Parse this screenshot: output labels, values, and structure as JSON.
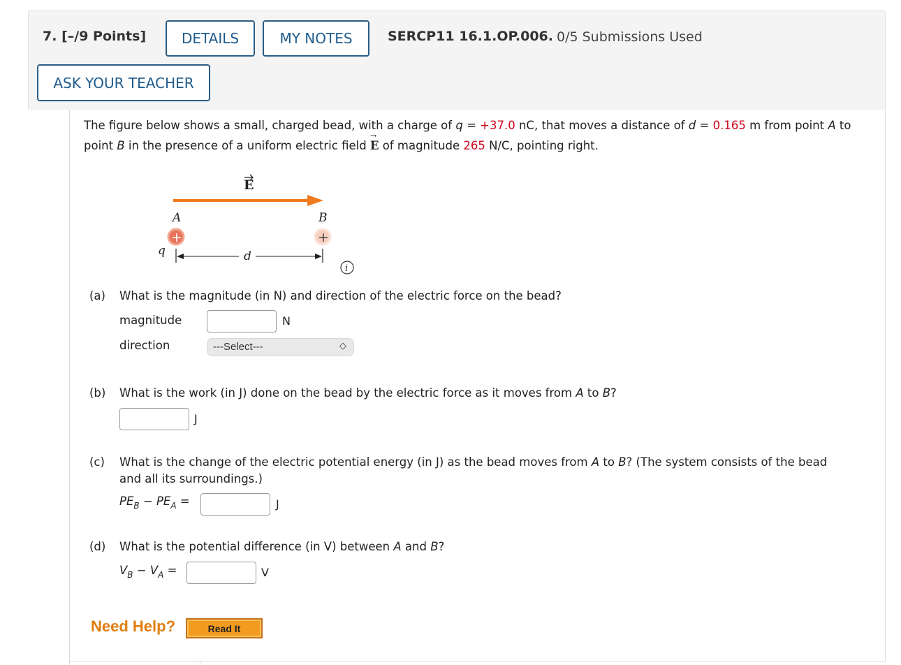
{
  "header": {
    "question_number": "7.",
    "points": "[–/9 Points]",
    "details_label": "DETAILS",
    "notes_label": "MY NOTES",
    "question_id": "SERCP11 16.1.OP.006.",
    "submissions": "0/5 Submissions Used",
    "ask_teacher_label": "ASK YOUR TEACHER"
  },
  "problem": {
    "t1": "The figure below shows a small, charged bead, with a charge of ",
    "q_sym": "q",
    "eq": " = ",
    "q_val": "+37.0",
    "t2": " nC, that moves a distance of ",
    "d_sym": "d",
    "eq2": " = ",
    "d_val": "0.165",
    "t3": " m from point ",
    "A": "A",
    "t4": " to point ",
    "B": "B",
    "t5": " in the presence of a uniform electric field ",
    "E": "E",
    "t6": " of magnitude ",
    "E_val": "265",
    "t7": " N/C, pointing right."
  },
  "figure": {
    "E_label": "E",
    "A_label": "A",
    "B_label": "B",
    "q_label": "q",
    "d_label": "d",
    "plus": "+",
    "info": "i",
    "colors": {
      "arrow": "#f07a1e",
      "bead_A": "#e8735a",
      "bead_B": "#f8cfc0"
    }
  },
  "parts": {
    "a": {
      "label": "(a)",
      "question": "What is the magnitude (in N) and direction of the electric force on the bead?",
      "magnitude_label": "magnitude",
      "magnitude_unit": "N",
      "direction_label": "direction",
      "direction_selected": "---Select---"
    },
    "b": {
      "label": "(b)",
      "q1": "What is the work (in J) done on the bead by the electric force as it moves from ",
      "A": "A",
      "to": " to ",
      "B": "B",
      "end": "?",
      "unit": "J"
    },
    "c": {
      "label": "(c)",
      "q1": "What is the change of the electric potential energy (in J) as the bead moves from ",
      "A": "A",
      "to": " to ",
      "B": "B",
      "q2": "? (The system consists of the bead",
      "line2": "and all its surroundings.)",
      "lhs_PE": "PE",
      "sub_B": "B",
      "minus": " − ",
      "sub_A": "A",
      "equals": " =",
      "unit": "J"
    },
    "d": {
      "label": "(d)",
      "q1": "What is the potential difference (in V) between ",
      "A": "A",
      "and": " and ",
      "B": "B",
      "end": "?",
      "lhs_V": "V",
      "sub_B": "B",
      "minus": " − ",
      "sub_A": "A",
      "equals": " =",
      "unit": "V"
    }
  },
  "help": {
    "need_help": "Need Help?",
    "read_it": "Read It"
  }
}
